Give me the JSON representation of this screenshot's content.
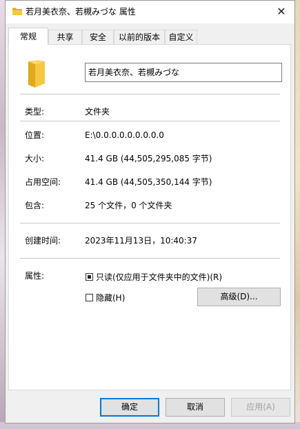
{
  "window": {
    "title": "若月美衣奈、若槻みづな 属性",
    "close_glyph": "✕"
  },
  "tabs": [
    {
      "label": "常规",
      "active": true
    },
    {
      "label": "共享",
      "active": false
    },
    {
      "label": "安全",
      "active": false
    },
    {
      "label": "以前的版本",
      "active": false
    },
    {
      "label": "自定义",
      "active": false
    }
  ],
  "general": {
    "folder_name": "若月美衣奈、若槻みづな",
    "type_label": "类型:",
    "type_value": "文件夹",
    "location_label": "位置:",
    "location_value": "E:\\0.0.0.0.0.0.0.0.0",
    "size_label": "大小:",
    "size_value": "41.4 GB (44,505,295,085 字节)",
    "size_on_disk_label": "占用空间:",
    "size_on_disk_value": "41.4 GB (44,505,350,144 字节)",
    "contains_label": "包含:",
    "contains_value": "25 个文件，0 个文件夹",
    "created_label": "创建时间:",
    "created_value": "2023年11月13日，10:40:37",
    "attributes_label": "属性:",
    "readonly_label": "只读(仅应用于文件夹中的文件)(R)",
    "readonly_checked": true,
    "hidden_label": "隐藏(H)",
    "hidden_checked": false,
    "advanced_button": "高级(D)..."
  },
  "footer": {
    "ok": "确定",
    "cancel": "取消",
    "apply": "应用(A)"
  },
  "colors": {
    "folder": "#f4c842",
    "folder_dark": "#e0a91e",
    "accent": "#0078d7"
  },
  "icons": {
    "title_icon": "folder-icon",
    "panel_icon": "folder-icon",
    "close": "close-icon"
  }
}
